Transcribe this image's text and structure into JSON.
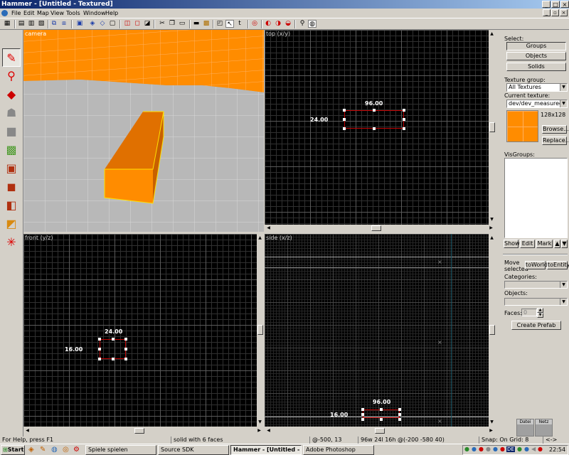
{
  "window": {
    "title": "Hammer - [Untitled - Textured]"
  },
  "menu": {
    "items": [
      "File",
      "Edit",
      "Map",
      "View",
      "Tools",
      "Window",
      "Help"
    ]
  },
  "viewports": {
    "camera": {
      "label": "camera"
    },
    "top": {
      "label": "top (x/y)",
      "width_label": "96.00",
      "height_label": "24.00"
    },
    "front": {
      "label": "front (y/z)",
      "width_label": "24.00",
      "height_label": "16.00"
    },
    "side": {
      "label": "side (x/z)",
      "width_label": "96.00",
      "height_label": "16.00"
    }
  },
  "right_panel": {
    "select_label": "Select:",
    "groups_button": "Groups",
    "objects_button": "Objects",
    "solids_button": "Solids",
    "texture_group_label": "Texture group:",
    "texture_group_value": "All Textures",
    "current_texture_label": "Current texture:",
    "current_texture_value": "dev/dev_measuregene",
    "texture_size": "128x128",
    "browse_button": "Browse...",
    "replace_button": "Replace...",
    "visgroups_label": "VisGroups:",
    "show_button": "Show",
    "edit_button": "Edit",
    "mark_button": "Mark",
    "move_selected_label": "Move selected",
    "to_world_button": "toWorld",
    "to_entity_button": "toEntity",
    "categories_label": "Categories:",
    "objects_label": "Objects:",
    "faces_label": "Faces:",
    "faces_value": "0",
    "create_prefab_button": "Create Prefab",
    "tab_labels": [
      "Datei",
      "Netz"
    ]
  },
  "status_bar": {
    "help": "For Help, press F1",
    "selection": "solid with 6 faces",
    "coords": "@-500, 13",
    "size": "96w 24l 16h @(-200 -580 40)",
    "snap": "Snap: On Grid: 8",
    "nav": "<->"
  },
  "taskbar": {
    "start": "Start",
    "tasks": [
      "Spiele spielen",
      "Source SDK",
      "Hammer - [Untitled - ...",
      "Adobe Photoshop"
    ],
    "language": "DE",
    "clock": "22:54"
  },
  "colors": {
    "brush": "#ff8c00",
    "selection": "#c00000",
    "viewport_bg": "#000000",
    "titlebar": "#0a246a"
  }
}
